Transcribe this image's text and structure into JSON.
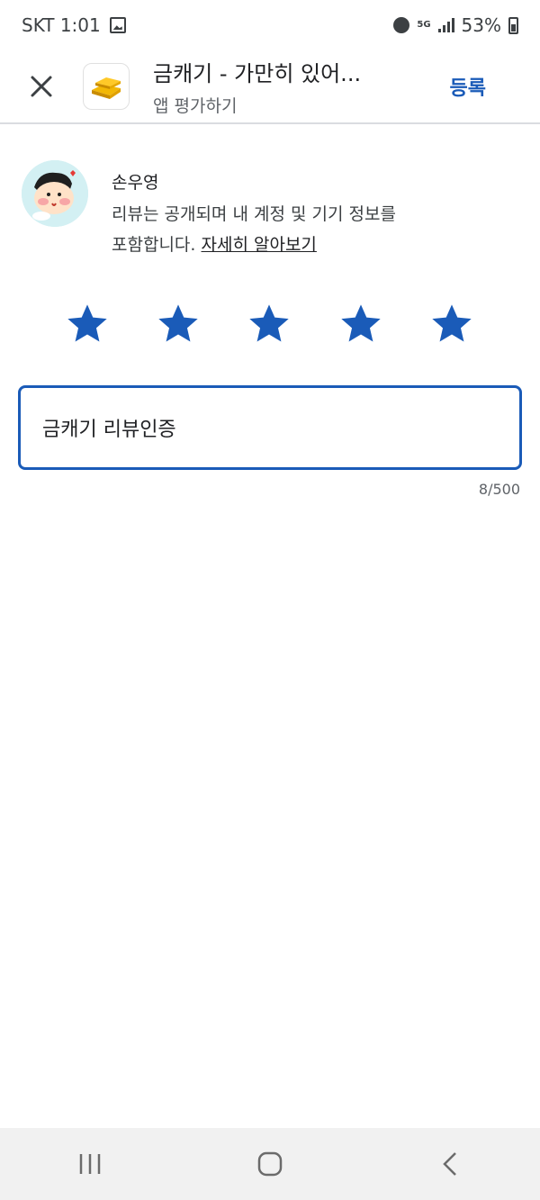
{
  "status_bar": {
    "carrier_time": "SKT 1:01",
    "network": "5G",
    "battery": "53%"
  },
  "app_bar": {
    "title": "금캐기 - 가만히 있어...",
    "subtitle": "앱 평가하기",
    "post_label": "등록",
    "close_icon": "close-icon",
    "app_icon": "gold-bars-icon"
  },
  "profile": {
    "name": "손우영",
    "disclaimer": "리뷰는 공개되며 내 계정 및 기기 정보를",
    "disclaimer_line2": "포함합니다.",
    "learn_more": "자세히 알아보기"
  },
  "rating": {
    "stars_selected": 5,
    "stars_total": 5,
    "color": "#1a5bb8"
  },
  "review": {
    "value": "금캐기 리뷰인증",
    "counter": "8/500"
  },
  "nav": {
    "recent_icon": "recent-apps-icon",
    "home_icon": "home-icon",
    "back_icon": "back-icon"
  },
  "colors": {
    "accent": "#1a5bb8",
    "nav_bg": "#f1f1f1"
  }
}
